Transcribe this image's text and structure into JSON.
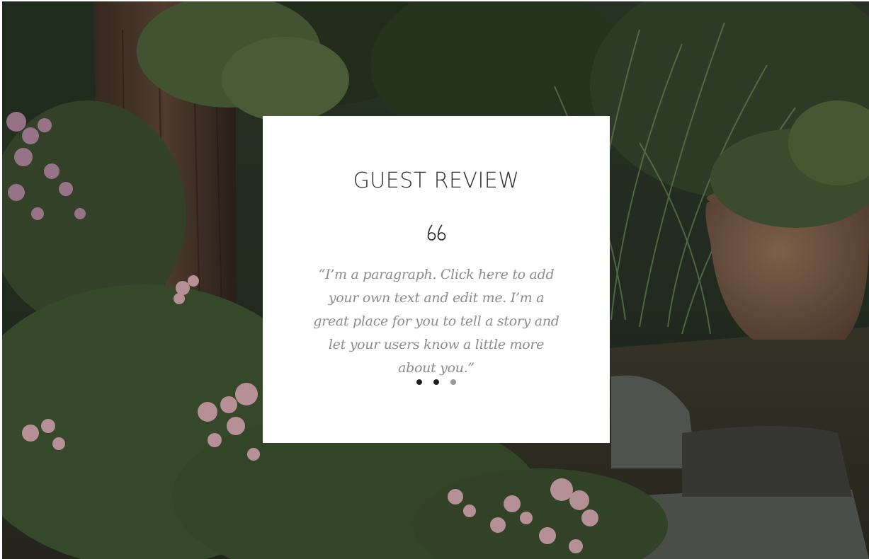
{
  "review": {
    "title": "GUEST REVIEW",
    "quote_icon": "quote-mark-icon",
    "text": "“I’m a paragraph. Click here to add your own text and edit me. I’m a great place for you to tell a story and let your users know a little more about you.”",
    "slides": [
      {
        "active": true
      },
      {
        "active": true
      },
      {
        "active": false
      }
    ]
  },
  "background": {
    "description_icon": "garden-background-image"
  },
  "colors": {
    "card": "#ffffff",
    "title": "#2e2e2e",
    "text": "#8c8c8c",
    "dot_active": "#222222",
    "dot_inactive": "#9a9a9a"
  }
}
